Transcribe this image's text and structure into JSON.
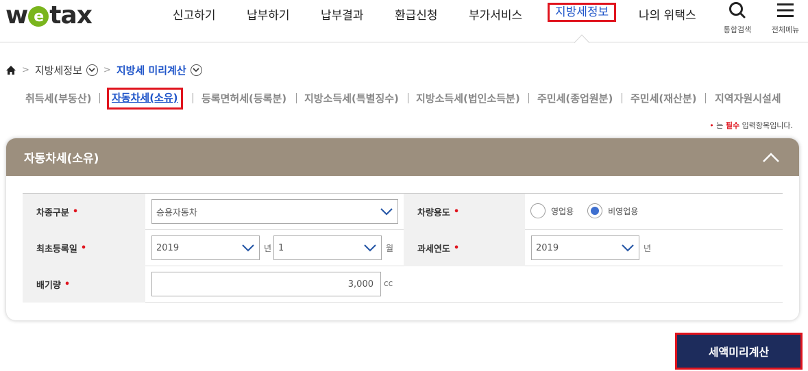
{
  "logo": {
    "pre": "w",
    "mark": "e",
    "post": "tax"
  },
  "gnb": {
    "items": [
      "신고하기",
      "납부하기",
      "납부결과",
      "환급신청",
      "부가서비스",
      "지방세정보",
      "나의 위택스"
    ],
    "active_index": 5
  },
  "util": {
    "search_label": "통합검색",
    "menu_label": "전체메뉴"
  },
  "breadcrumb": {
    "level1": "지방세정보",
    "level2": "지방세 미리계산"
  },
  "subtabs": {
    "items": [
      "취득세(부동산)",
      "자동차세(소유)",
      "등록면허세(등록분)",
      "지방소득세(특별징수)",
      "지방소득세(법인소득분)",
      "주민세(종업원분)",
      "주민세(재산분)",
      "지역자원시설세"
    ],
    "active_index": 1
  },
  "required_note": {
    "bullet": "•",
    "pre": " 는 ",
    "emph": "필수",
    "post": " 입력항목입니다."
  },
  "panel": {
    "title": "자동차세(소유)",
    "form": {
      "vehicle_type": {
        "label": "차종구분",
        "value": "승용자동차"
      },
      "vehicle_use": {
        "label": "차량용도",
        "options": [
          "영업용",
          "비영업용"
        ],
        "selected": "비영업용"
      },
      "first_registration": {
        "label": "최초등록일",
        "year": "2019",
        "year_unit": "년",
        "month": "1",
        "month_unit": "월"
      },
      "tax_year": {
        "label": "과세연도",
        "value": "2019",
        "unit": "년"
      },
      "displacement": {
        "label": "배기량",
        "value": "3,000",
        "unit": "cc"
      },
      "required_mark": "•"
    }
  },
  "calc_button": "세액미리계산",
  "colors": {
    "accent_red": "#e0141e",
    "link_blue": "#1f55c9",
    "panel_head": "#9c8f7e",
    "button_navy": "#1d2c5c",
    "logo_green": "#7ab51d"
  }
}
